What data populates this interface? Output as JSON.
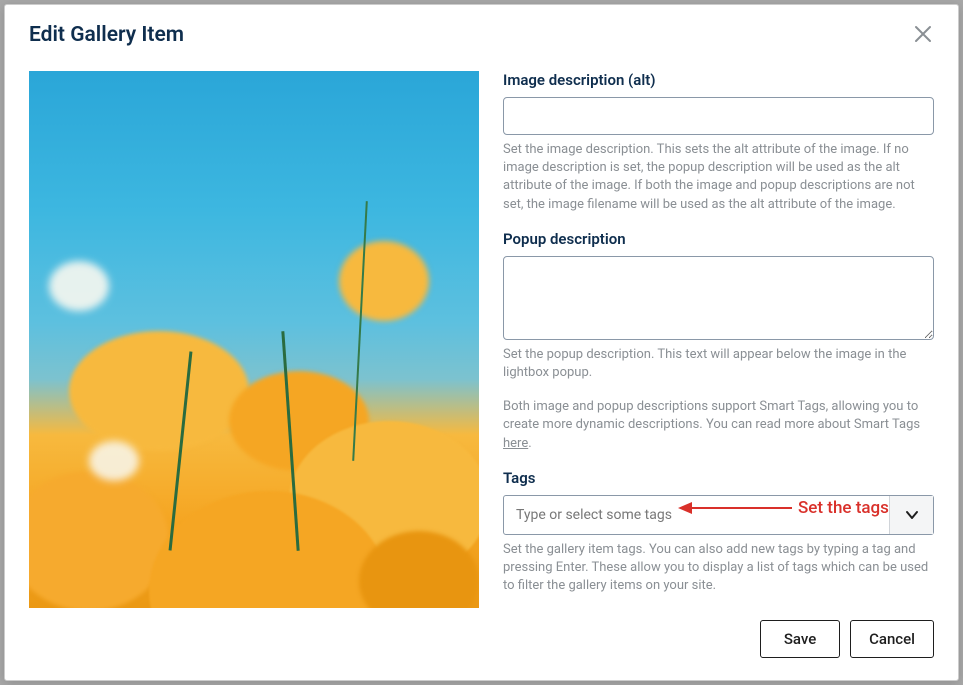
{
  "modal": {
    "title": "Edit Gallery Item"
  },
  "fields": {
    "alt": {
      "label": "Image description (alt)",
      "value": "",
      "help": "Set the image description. This sets the alt attribute of the image. If no image description is set, the popup description will be used as the alt attribute of the image. If both the image and popup descriptions are not set, the image filename will be used as the alt attribute of the image."
    },
    "popup": {
      "label": "Popup description",
      "value": "",
      "help": "Set the popup description. This text will appear below the image in the lightbox popup."
    },
    "smart_tags_note": {
      "text_before": "Both image and popup descriptions support Smart Tags, allowing you to create more dynamic descriptions. You can read more about Smart Tags ",
      "link_text": "here",
      "text_after": "."
    },
    "tags": {
      "label": "Tags",
      "placeholder": "Type or select some tags",
      "help": "Set the gallery item tags. You can also add new tags by typing a tag and pressing Enter. These allow you to display a list of tags which can be used to filter the gallery items on your site."
    }
  },
  "annotation": {
    "label": "Set the tags"
  },
  "actions": {
    "save": "Save",
    "cancel": "Cancel"
  }
}
